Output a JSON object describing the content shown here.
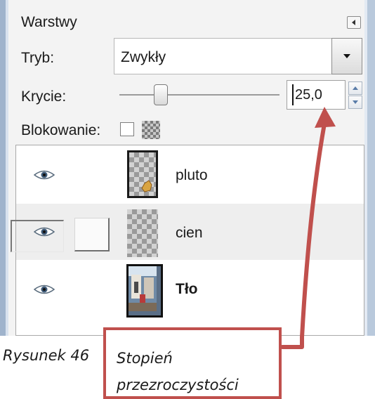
{
  "panel": {
    "title": "Warstwy",
    "mode": {
      "label": "Tryb:",
      "value": "Zwykły"
    },
    "opacity": {
      "label": "Krycie:",
      "value": "25,0",
      "slider_fraction": 0.25
    },
    "lock": {
      "label": "Blokowanie:"
    },
    "layers": [
      {
        "name": "pluto",
        "visible": true,
        "selected": false
      },
      {
        "name": "cien",
        "visible": true,
        "selected": true
      },
      {
        "name": "Tło",
        "visible": true,
        "selected": false
      }
    ]
  },
  "annotation": {
    "caption": "Rysunek 46",
    "callout_line1": "Stopień",
    "callout_line2": "przezroczystości",
    "color": "#c0504d"
  }
}
